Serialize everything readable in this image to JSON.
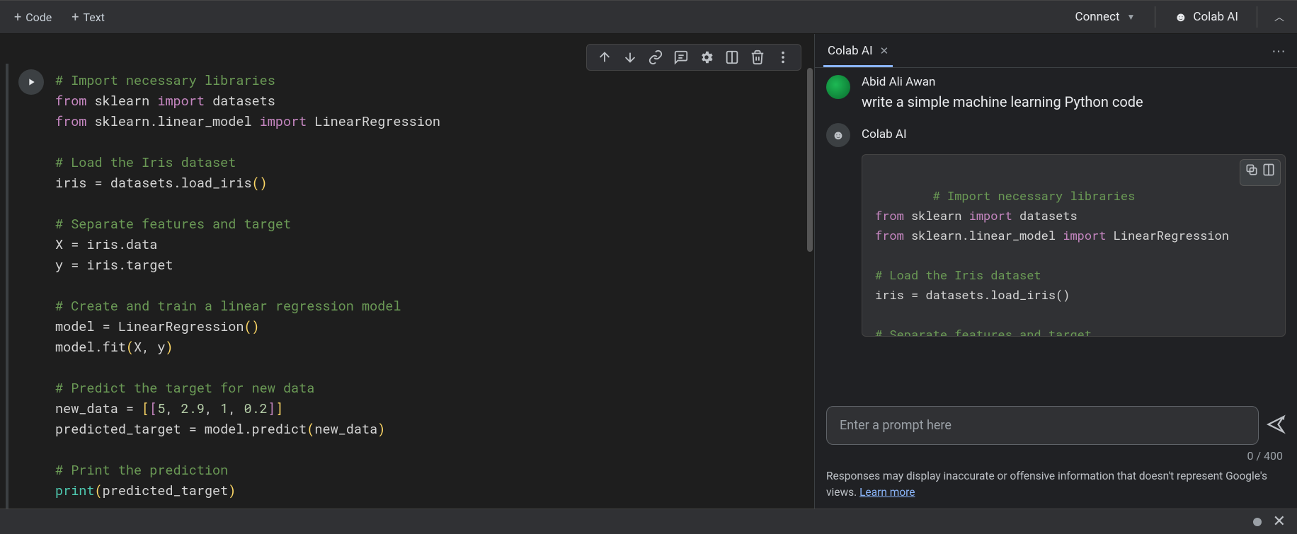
{
  "toolbar": {
    "addCode": "Code",
    "addText": "Text",
    "connect": "Connect",
    "colabAi": "Colab AI"
  },
  "code": {
    "c1": "# Import necessary libraries",
    "l2a": "from",
    "l2b": " sklearn ",
    "l2c": "import",
    "l2d": " datasets",
    "l3a": "from",
    "l3b": " sklearn.linear_model ",
    "l3c": "import",
    "l3d": " LinearRegression",
    "c4": "# Load the Iris dataset",
    "l5": "iris = datasets.load_iris()",
    "c6": "# Separate features and target",
    "l7": "X = iris.data",
    "l8": "y = iris.target",
    "c9": "# Create and train a linear regression model",
    "l10": "model = LinearRegression()",
    "l11": "model.fit(X, y)",
    "c12": "# Predict the target for new data",
    "l13": "new_data = [[5, 2.9, 1, 0.2]]",
    "l14": "predicted_target = model.predict(new_data)",
    "c15": "# Print the prediction",
    "l16": "print(predicted_target)"
  },
  "ai": {
    "tabLabel": "Colab AI",
    "userName": "Abid Ali Awan",
    "userMsg": "write a simple machine learning Python code",
    "botName": "Colab AI",
    "inputPlaceholder": "Enter a prompt here",
    "counter": "0 / 400",
    "disclaimer": "Responses may display inaccurate or offensive information that doesn't represent Google's views. ",
    "learnMore": "Learn more",
    "code": {
      "c1": "# Import necessary libraries",
      "l2a": "from",
      "l2b": " sklearn ",
      "l2c": "import",
      "l2d": " datasets",
      "l3a": "from",
      "l3b": " sklearn.linear_model ",
      "l3c": "import",
      "l3d": " LinearRegression",
      "c4": "# Load the Iris dataset",
      "l5": "iris = datasets.load_iris()",
      "c6": "# Separate features and target"
    }
  }
}
